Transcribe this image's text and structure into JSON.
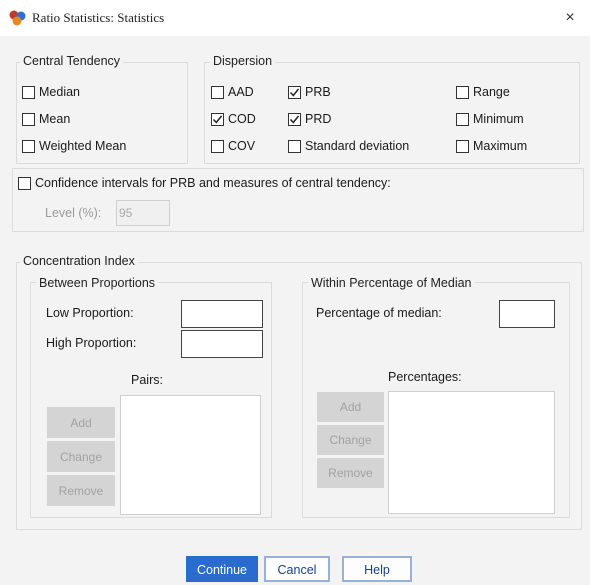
{
  "window": {
    "title": "Ratio Statistics: Statistics",
    "close_glyph": "×",
    "icon": "spss-app-icon"
  },
  "central_tendency": {
    "legend": "Central Tendency",
    "items": [
      {
        "label": "Median",
        "checked": false
      },
      {
        "label": "Mean",
        "checked": false
      },
      {
        "label": "Weighted Mean",
        "checked": false
      }
    ]
  },
  "dispersion": {
    "legend": "Dispersion",
    "items": [
      {
        "label": "AAD",
        "checked": false
      },
      {
        "label": "COD",
        "checked": true
      },
      {
        "label": "COV",
        "checked": false
      },
      {
        "label": "PRB",
        "checked": true
      },
      {
        "label": "PRD",
        "checked": true
      },
      {
        "label": "Standard deviation",
        "checked": false
      },
      {
        "label": "Range",
        "checked": false
      },
      {
        "label": "Minimum",
        "checked": false
      },
      {
        "label": "Maximum",
        "checked": false
      }
    ]
  },
  "confidence": {
    "label": "Confidence intervals for PRB and measures of central tendency:",
    "checked": false,
    "level_label": "Level (%):",
    "level_value": "95"
  },
  "concentration": {
    "legend": "Concentration Index",
    "between": {
      "legend": "Between Proportions",
      "low_label": "Low Proportion:",
      "high_label": "High Proportion:",
      "pairs_label": "Pairs:",
      "buttons": [
        "Add",
        "Change",
        "Remove"
      ]
    },
    "within": {
      "legend": "Within Percentage of Median",
      "pct_label": "Percentage of median:",
      "percentages_label": "Percentages:",
      "buttons": [
        "Add",
        "Change",
        "Remove"
      ]
    }
  },
  "footer": {
    "continue": "Continue",
    "cancel": "Cancel",
    "help": "Help"
  },
  "colors": {
    "primary": "#2a6ccd",
    "check": "#222222",
    "disabled_text": "#a2a2a2"
  }
}
